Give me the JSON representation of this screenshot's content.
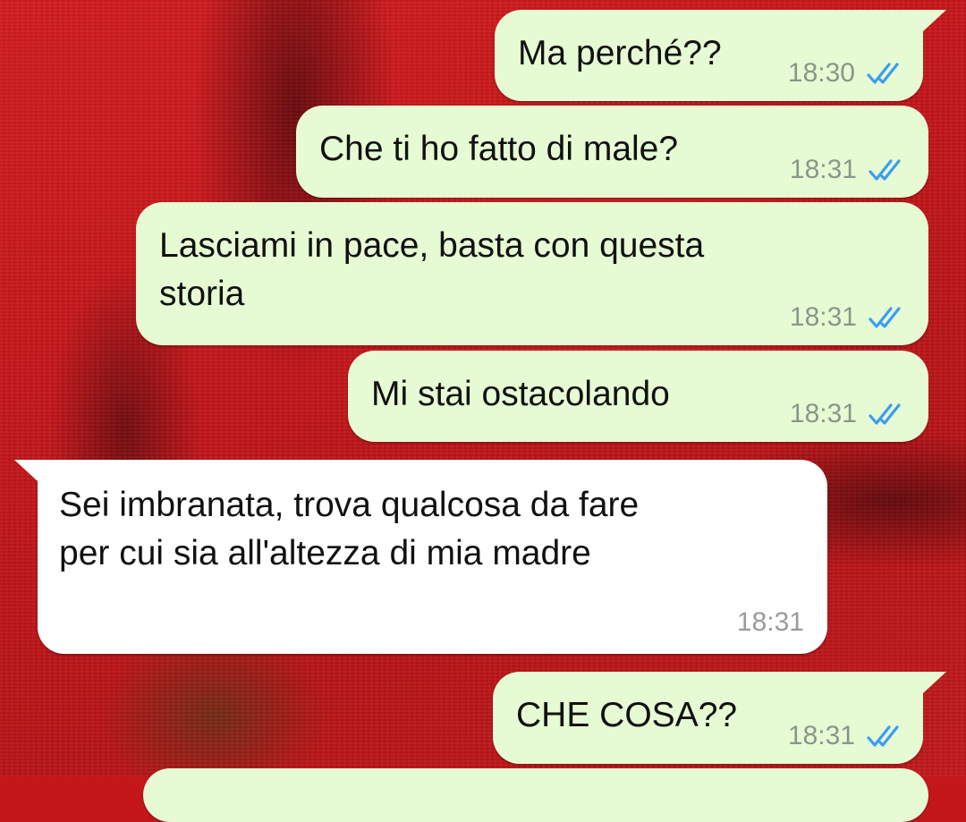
{
  "colors": {
    "outgoing_bubble": "#e6fbd3",
    "incoming_bubble": "#ffffff",
    "read_ticks": "#3b9df1",
    "wallpaper": "#c4171b"
  },
  "icons": {
    "read_status": "double-check-icon"
  },
  "messages": [
    {
      "direction": "outgoing",
      "text": "Ma perché??",
      "time": "18:30",
      "status": "read"
    },
    {
      "direction": "outgoing",
      "text": "Che ti ho fatto di male?",
      "time": "18:31",
      "status": "read"
    },
    {
      "direction": "outgoing",
      "text": "Lasciami in pace, basta con questa\nstoria",
      "time": "18:31",
      "status": "read"
    },
    {
      "direction": "outgoing",
      "text": "Mi stai ostacolando",
      "time": "18:31",
      "status": "read"
    },
    {
      "direction": "incoming",
      "text": "Sei imbranata, trova qualcosa da fare\nper cui sia all'altezza di mia madre",
      "time": "18:31"
    },
    {
      "direction": "outgoing",
      "text": "CHE COSA??",
      "time": "18:31",
      "status": "read"
    }
  ]
}
